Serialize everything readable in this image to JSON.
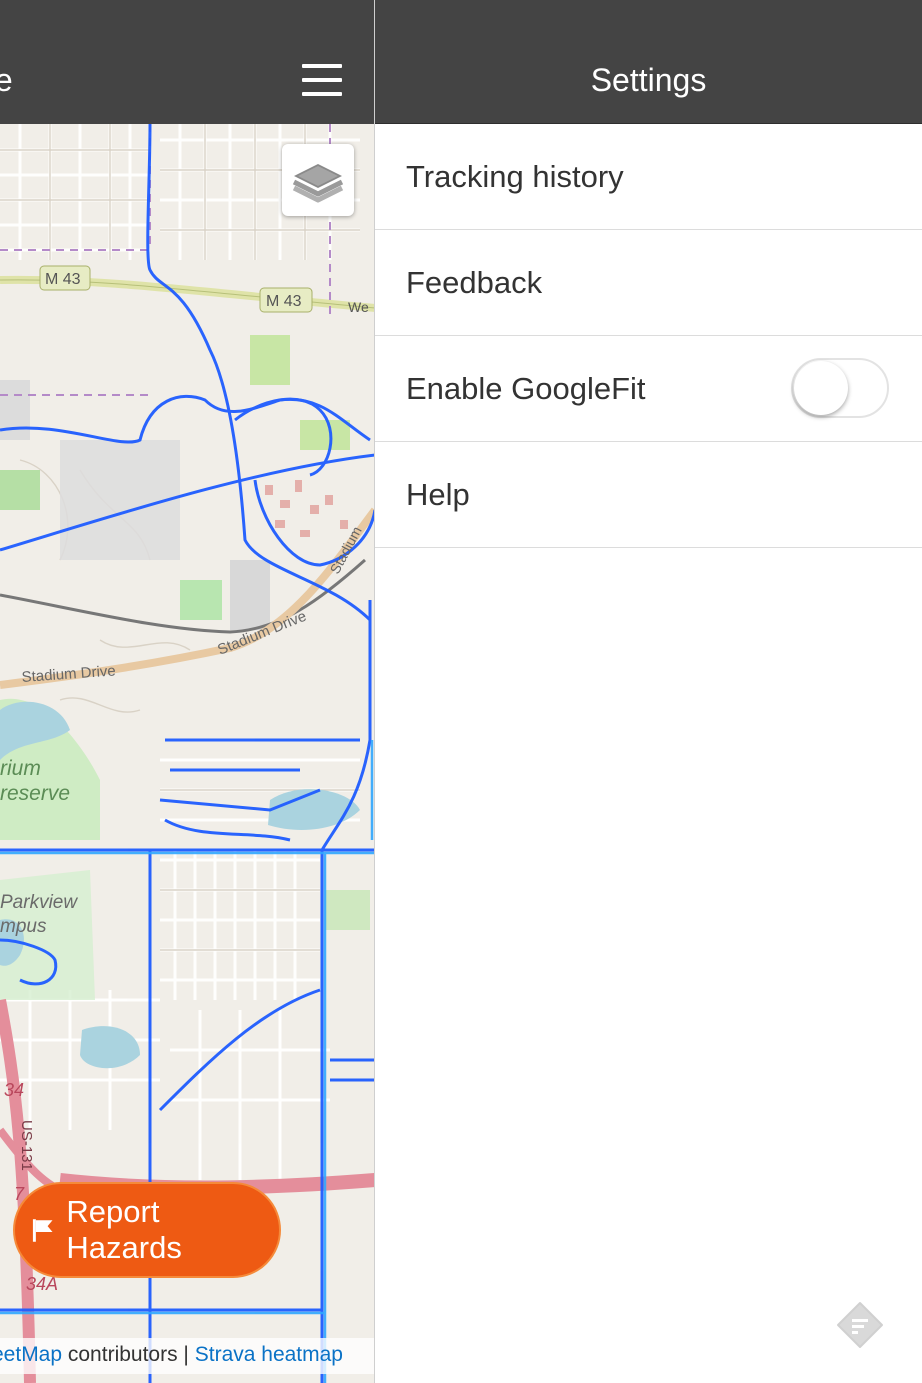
{
  "map": {
    "header_title": "te",
    "report_button_label": "Report Hazards",
    "attribution": {
      "osm_text": "eetMap",
      "contributors_text": " contributors | ",
      "strava_text": "Strava heatmap"
    },
    "labels": {
      "m43_a": "M 43",
      "m43_b": "M 43",
      "west": "We",
      "stadium_1": "Stadium Drive",
      "stadium_2": "Stadium Drive",
      "stadium_3": "Stadium",
      "preserve_1": "rium",
      "preserve_2": "reserve",
      "parkview_1": "Parkview",
      "parkview_2": "mpus",
      "route_34": "34",
      "route_34a": "34A",
      "route_us131": "US-131",
      "route_7": "7"
    },
    "colors": {
      "heatmap": "#1f5cff",
      "orange_accent": "#ee5a13",
      "header_bg": "#444444"
    }
  },
  "settings": {
    "title": "Settings",
    "items": [
      {
        "label": "Tracking history"
      },
      {
        "label": "Feedback"
      },
      {
        "label": "Enable GoogleFit",
        "toggle_on": false
      },
      {
        "label": "Help"
      }
    ]
  }
}
